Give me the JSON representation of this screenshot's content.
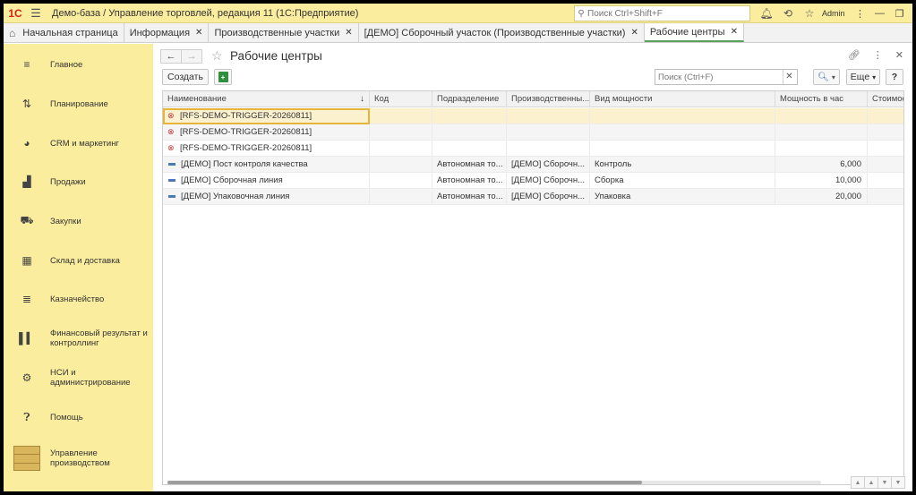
{
  "window": {
    "logo": "1С",
    "title": "Демо-база / Управление торговлей, редакция 11  (1С:Предприятие)",
    "search_placeholder": "Поиск Ctrl+Shift+F",
    "user": "Admin"
  },
  "tabs": [
    {
      "label": "Начальная страница",
      "closable": false
    },
    {
      "label": "Информация",
      "closable": true
    },
    {
      "label": "Производственные участки",
      "closable": true
    },
    {
      "label": "[ДЕМО] Сборочный участок (Производственные участки)",
      "closable": true
    },
    {
      "label": "Рабочие центры",
      "closable": true,
      "active": true
    }
  ],
  "sidebar": {
    "items": [
      {
        "label": "Главное",
        "icon": "menu-lines-icon"
      },
      {
        "label": "Планирование",
        "icon": "planning-icon"
      },
      {
        "label": "CRM и маркетинг",
        "icon": "pie-chart-icon"
      },
      {
        "label": "Продажи",
        "icon": "bag-icon"
      },
      {
        "label": "Закупки",
        "icon": "cart-icon"
      },
      {
        "label": "Склад и доставка",
        "icon": "grid-icon"
      },
      {
        "label": "Казначейство",
        "icon": "coins-icon"
      },
      {
        "label": "Финансовый результат и контроллинг",
        "icon": "bar-chart-icon"
      },
      {
        "label": "НСИ и администрирование",
        "icon": "gear-icon"
      },
      {
        "label": "Помощь",
        "icon": "help-icon"
      },
      {
        "label": "Управление производством",
        "icon": "crate-icon"
      }
    ]
  },
  "main": {
    "title": "Рабочие центры",
    "create_label": "Создать",
    "search_placeholder": "Поиск (Ctrl+F)",
    "more_label": "Еще",
    "help_label": "?"
  },
  "table": {
    "columns": [
      "Наименование",
      "Код",
      "Подразделение",
      "Производственны...",
      "Вид мощности",
      "Мощность в час",
      "Стоимос"
    ],
    "rows": [
      {
        "name": "[RFS-DEMO-TRIGGER-20260811]",
        "code": "",
        "dept": "",
        "area": "",
        "type": "",
        "power": "",
        "cost": "",
        "status": "deleted"
      },
      {
        "name": "[RFS-DEMO-TRIGGER-20260811]",
        "code": "",
        "dept": "",
        "area": "",
        "type": "",
        "power": "",
        "cost": "",
        "status": "deleted"
      },
      {
        "name": "[RFS-DEMO-TRIGGER-20260811]",
        "code": "",
        "dept": "",
        "area": "",
        "type": "",
        "power": "",
        "cost": "",
        "status": "deleted"
      },
      {
        "name": "[ДЕМО] Пост контроля качества",
        "code": "",
        "dept": "Автономная то...",
        "area": "[ДЕМО] Сборочн...",
        "type": "Контроль",
        "power": "6,000",
        "cost": "",
        "status": "active"
      },
      {
        "name": "[ДЕМО] Сборочная линия",
        "code": "",
        "dept": "Автономная то...",
        "area": "[ДЕМО] Сборочн...",
        "type": "Сборка",
        "power": "10,000",
        "cost": "",
        "status": "active"
      },
      {
        "name": "[ДЕМО] Упаковочная линия",
        "code": "",
        "dept": "Автономная то...",
        "area": "[ДЕМО] Сборочн...",
        "type": "Упаковка",
        "power": "20,000",
        "cost": "",
        "status": "active"
      }
    ]
  },
  "colors": {
    "accent_yellow": "#fbed9e",
    "selection": "#fbf1cf",
    "active_tab_underline": "#5aa05a"
  }
}
